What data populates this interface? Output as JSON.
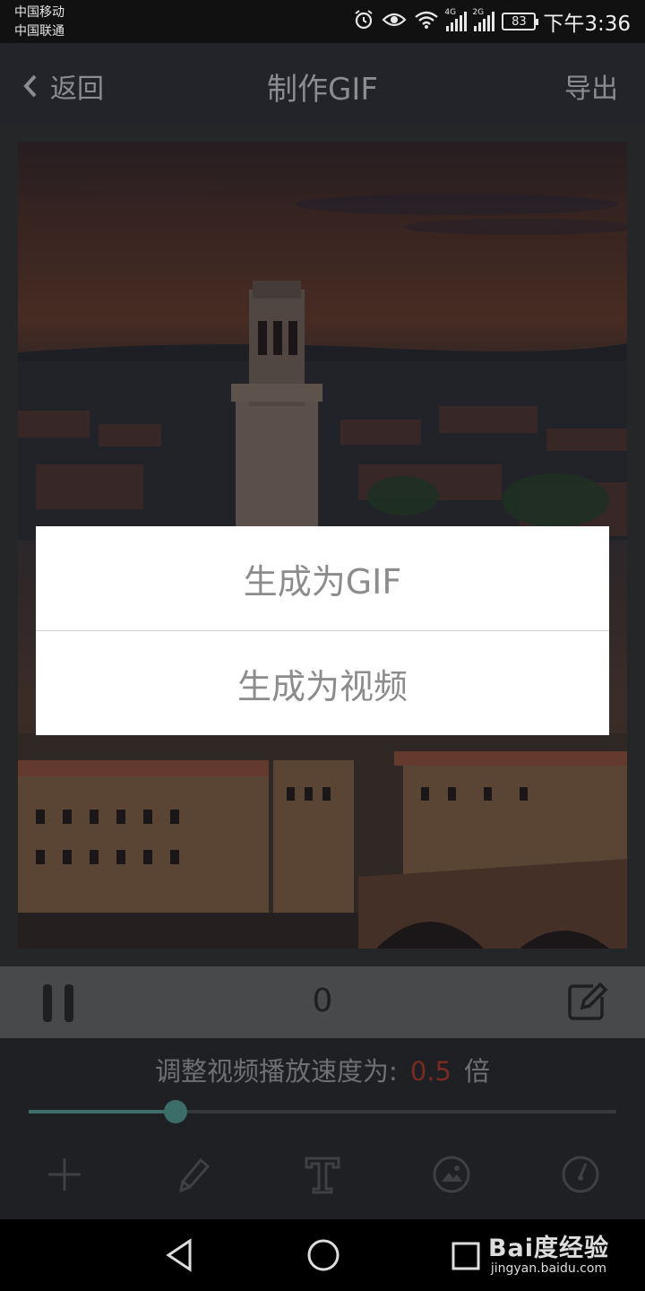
{
  "status_bar": {
    "carrier_1": "中国移动",
    "carrier_2": "中国联通",
    "signal_1_label": "4G",
    "signal_2_label": "2G",
    "battery": "83",
    "time": "下午3:36",
    "icons": [
      "alarm-icon",
      "eye-icon",
      "wifi-icon",
      "signal-icon",
      "signal-icon",
      "battery-icon"
    ]
  },
  "header": {
    "back_label": "返回",
    "title": "制作GIF",
    "export_label": "导出"
  },
  "player": {
    "frame_counter": "0",
    "icons": [
      "pause-icon",
      "edit-icon"
    ]
  },
  "speed": {
    "prefix": "调整视频播放速度为:",
    "value": "0.5",
    "suffix": "倍",
    "slider_fraction": 0.25,
    "value_color": "#7a2a20",
    "accent_color": "#3c6d68"
  },
  "toolbar": {
    "icons": [
      "add-icon",
      "pencil-icon",
      "text-icon",
      "image-icon",
      "speed-dial-icon"
    ]
  },
  "dialog": {
    "option_gif": "生成为GIF",
    "option_video": "生成为视频"
  },
  "nav": {
    "icons": [
      "back-triangle-icon",
      "home-circle-icon",
      "recents-square-icon"
    ]
  },
  "watermark": {
    "logo": "Bai度经验",
    "url": "jingyan.baidu.com"
  }
}
